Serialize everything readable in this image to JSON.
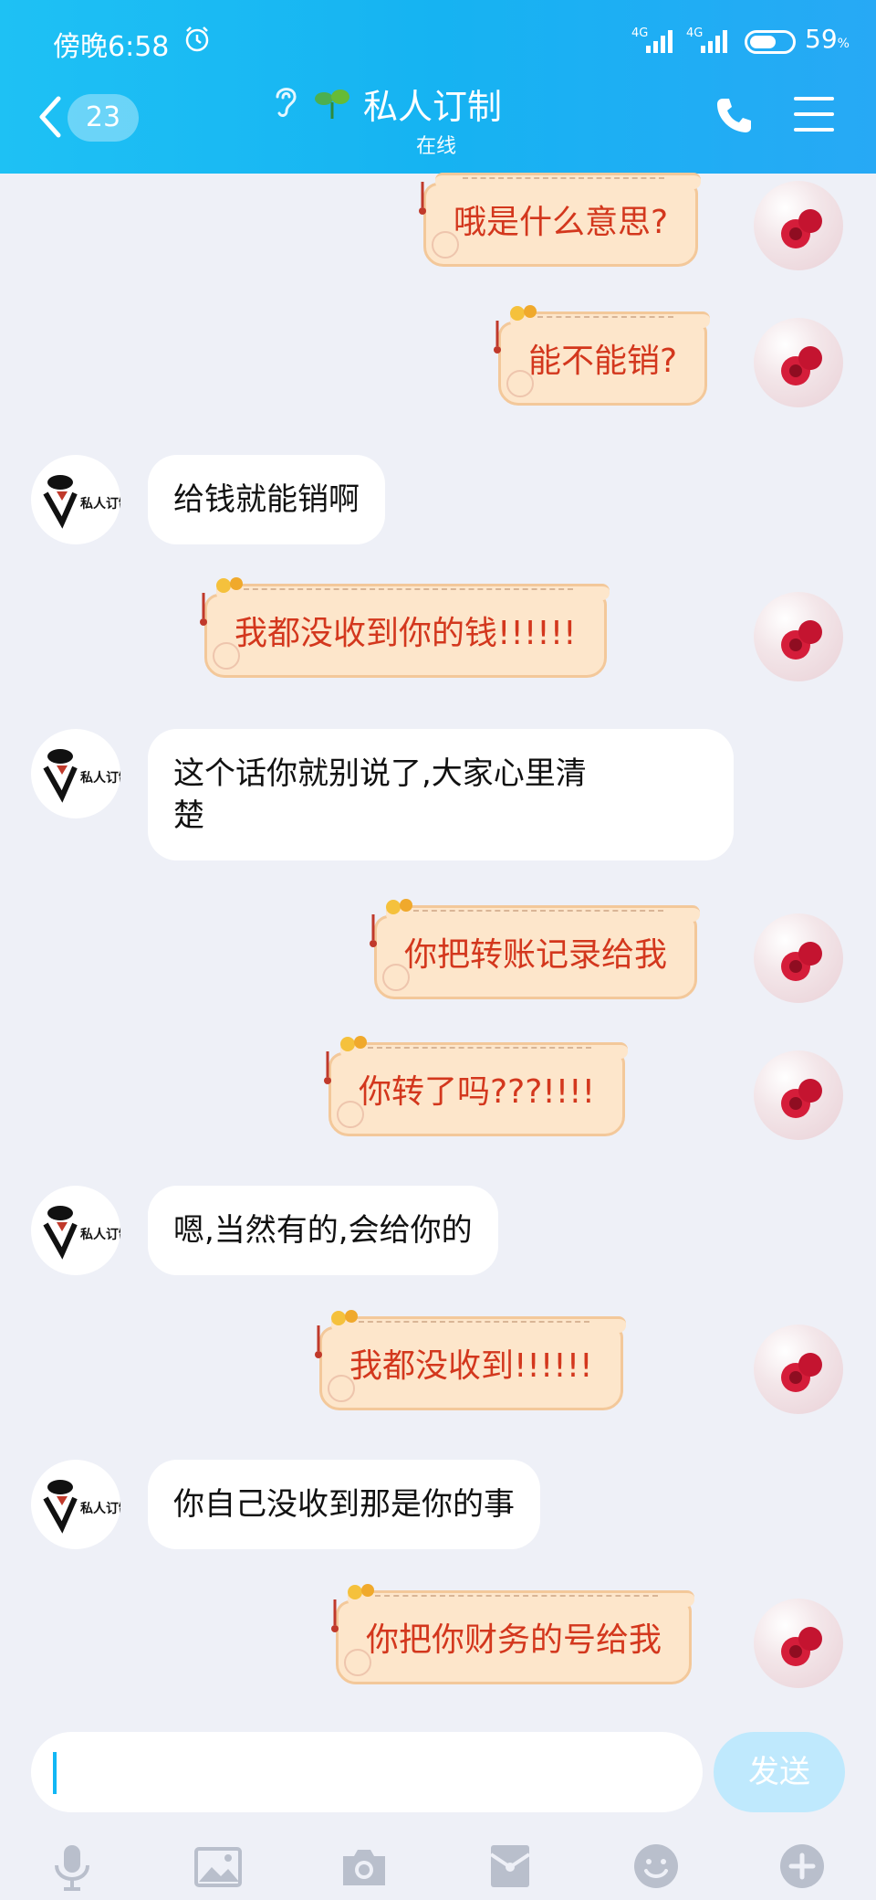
{
  "status_bar": {
    "time": "傍晚6:58",
    "network1": "4G",
    "network2": "4G",
    "battery": "59",
    "battery_unit": "%"
  },
  "header": {
    "unread_count": "23",
    "title": "私人订制",
    "subtitle": "在线"
  },
  "messages": [
    {
      "side": "right",
      "text": "哦是什么意思?"
    },
    {
      "side": "right",
      "text": "能不能销?"
    },
    {
      "side": "left",
      "text": "给钱就能销啊"
    },
    {
      "side": "right",
      "text": "我都没收到你的钱!!!!!!"
    },
    {
      "side": "left",
      "text": "这个话你就别说了,大家心里清",
      "text2": "楚"
    },
    {
      "side": "right",
      "text": "你把转账记录给我"
    },
    {
      "side": "right",
      "text": "你转了吗???!!!!"
    },
    {
      "side": "left",
      "text": "嗯,当然有的,会给你的"
    },
    {
      "side": "right",
      "text": "我都没收到!!!!!!"
    },
    {
      "side": "left",
      "text": "你自己没收到那是你的事"
    },
    {
      "side": "right",
      "text": "你把你财务的号给我"
    }
  ],
  "contact_avatar_text": "私人订制",
  "input": {
    "send_label": "发送"
  },
  "toolbar_icons": [
    "mic-icon",
    "image-icon",
    "camera-icon",
    "red-packet-icon",
    "emoji-icon",
    "plus-icon"
  ]
}
